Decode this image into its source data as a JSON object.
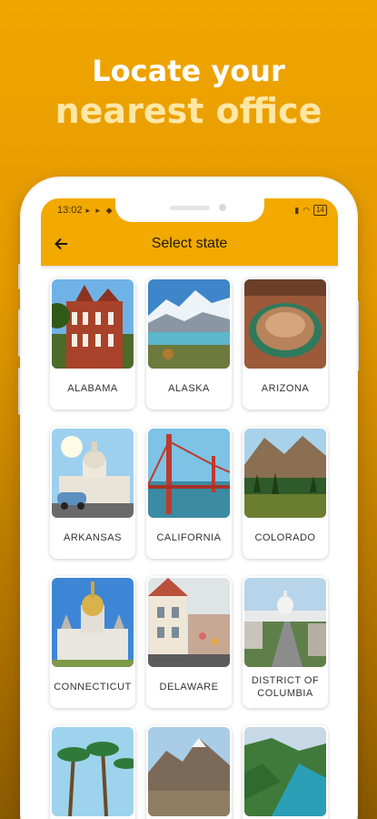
{
  "promo": {
    "line1": "Locate your",
    "line2": "nearest office"
  },
  "status_bar": {
    "time": "13:02",
    "battery": "14"
  },
  "app_bar": {
    "title": "Select state",
    "back_icon": "arrow-left-icon"
  },
  "states": [
    {
      "name": "ALABAMA"
    },
    {
      "name": "ALASKA"
    },
    {
      "name": "ARIZONA"
    },
    {
      "name": "ARKANSAS"
    },
    {
      "name": "CALIFORNIA"
    },
    {
      "name": "COLORADO"
    },
    {
      "name": "CONNECTICUT"
    },
    {
      "name": "DELAWARE"
    },
    {
      "name": "DISTRICT OF COLUMBIA"
    },
    {
      "name": ""
    },
    {
      "name": ""
    },
    {
      "name": ""
    }
  ],
  "colors": {
    "accent": "#f2a900",
    "background_top": "#f0a500",
    "background_bottom": "#8a5a00"
  }
}
